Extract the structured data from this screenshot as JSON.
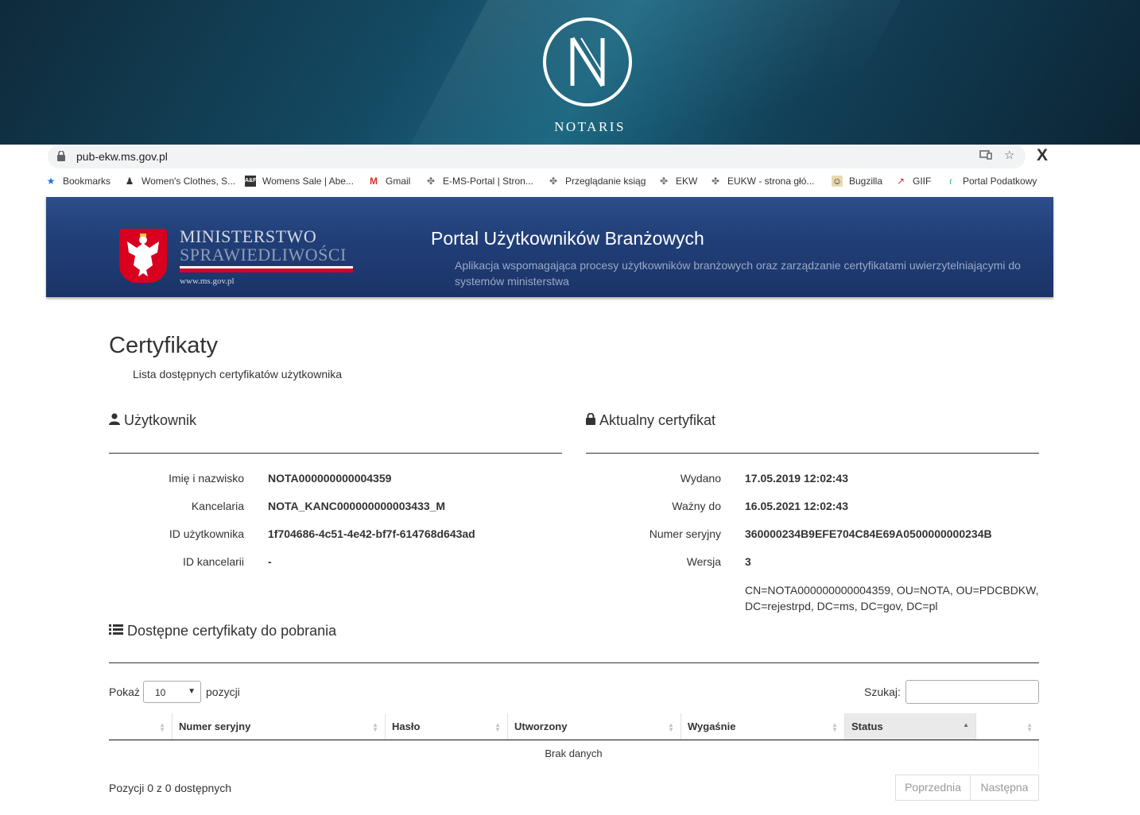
{
  "banner": {
    "logo_letter": "N",
    "logo_word": "NOTARIS"
  },
  "browser": {
    "url": "pub-ekw.ms.gov.pl",
    "close_label": "X",
    "bookmarks": [
      {
        "label": "Bookmarks",
        "icon": "star-icon"
      },
      {
        "label": "Women's Clothes, S...",
        "icon": "figure-icon"
      },
      {
        "label": "Womens Sale | Abe...",
        "icon": "af-icon"
      },
      {
        "label": "Gmail",
        "icon": "gmail-icon"
      },
      {
        "label": "E-MS-Portal | Stron...",
        "icon": "eagle-icon"
      },
      {
        "label": "Przeglądanie ksiąg",
        "icon": "eagle-icon"
      },
      {
        "label": "EKW",
        "icon": "eagle-icon"
      },
      {
        "label": "EUKW - strona głó...",
        "icon": "eagle-icon"
      },
      {
        "label": "Bugzilla",
        "icon": "bug-icon"
      },
      {
        "label": "GIIF",
        "icon": "chart-icon"
      },
      {
        "label": "Portal Podatkowy",
        "icon": "portal-icon"
      }
    ]
  },
  "header": {
    "ministry_line1": "MINISTERSTWO",
    "ministry_line2": "SPRAWIEDLIWOŚCI",
    "ministry_url": "www.ms.gov.pl",
    "portal_title": "Portal Użytkowników Branżowych",
    "portal_subtitle": "Aplikacja wspomagająca procesy użytkowników branżowych oraz zarządzanie certyfikatami uwierzytelniającymi do systemów ministerstwa"
  },
  "page": {
    "title": "Certyfikaty",
    "subtitle": "Lista dostępnych certyfikatów użytkownika"
  },
  "user": {
    "heading": "Użytkownik",
    "fields": [
      {
        "label": "Imię i nazwisko",
        "value": "NOTA000000000004359"
      },
      {
        "label": "Kancelaria",
        "value": "NOTA_KANC000000000003433_M"
      },
      {
        "label": "ID użytkownika",
        "value": "1f704686-4c51-4e42-bf7f-614768d643ad"
      },
      {
        "label": "ID kancelarii",
        "value": "-"
      }
    ]
  },
  "certificate": {
    "heading": "Aktualny certyfikat",
    "fields": [
      {
        "label": "Wydano",
        "value": "17.05.2019 12:02:43"
      },
      {
        "label": "Ważny do",
        "value": "16.05.2021 12:02:43"
      },
      {
        "label": "Numer seryjny",
        "value": "360000234B9EFE704C84E69A0500000000234B"
      },
      {
        "label": "Wersja",
        "value": "3"
      }
    ],
    "dn": "CN=NOTA000000000004359, OU=NOTA, OU=PDCBDKW, DC=rejestrpd, DC=ms, DC=gov, DC=pl"
  },
  "downloads": {
    "heading": "Dostępne certyfikaty do pobrania",
    "show_label": "Pokaż",
    "show_value": "10",
    "show_suffix": "pozycji",
    "search_label": "Szukaj:",
    "columns": [
      "",
      "Numer seryjny",
      "Hasło",
      "Utworzony",
      "Wygaśnie",
      "Status",
      ""
    ],
    "empty_text": "Brak danych",
    "info": "Pozycji 0 z 0 dostępnych",
    "prev_label": "Poprzednia",
    "next_label": "Następna"
  }
}
